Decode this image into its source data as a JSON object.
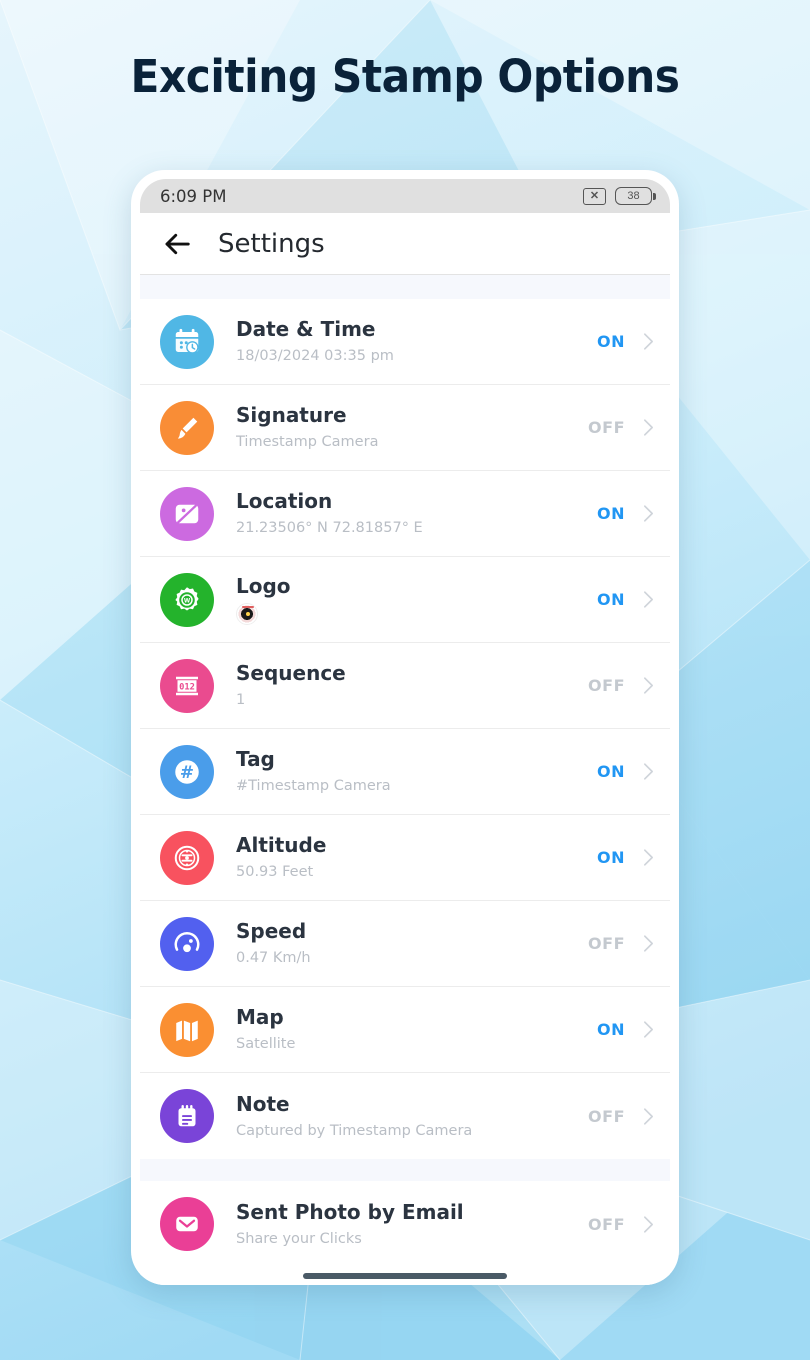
{
  "headline": "Exciting Stamp Options",
  "theme": {
    "background_top": "#e3f4fb",
    "background_bottom": "#a3dcf4",
    "headline_color": "#0a2239",
    "on_color": "#2196f3",
    "off_color": "#c4c9cf"
  },
  "phone": {
    "status_bar": {
      "time": "6:09 PM",
      "sim_icon": "sim-off-icon",
      "sim_glyph": "✕",
      "battery_level": "38"
    },
    "app_bar": {
      "back_icon": "back-arrow-icon",
      "title": "Settings"
    },
    "list": [
      {
        "name": "date-time",
        "title": "Date & Time",
        "subtitle": "18/03/2024 03:35 pm",
        "state": "ON",
        "icon": "calendar-clock-icon",
        "icon_color": "#50b7e5"
      },
      {
        "name": "signature",
        "title": "Signature",
        "subtitle": "Timestamp Camera",
        "state": "OFF",
        "icon": "signature-pen-icon",
        "icon_color": "#f98d36"
      },
      {
        "name": "location",
        "title": "Location",
        "subtitle": "21.23506° N 72.81857° E",
        "state": "ON",
        "icon": "map-pin-icon",
        "icon_color": "#cc6ae0"
      },
      {
        "name": "logo",
        "title": "Logo",
        "subtitle": "",
        "subtitle_is_thumbnail": true,
        "state": "ON",
        "icon": "logo-badge-icon",
        "icon_color": "#24b32c"
      },
      {
        "name": "sequence",
        "title": "Sequence",
        "subtitle": "1",
        "state": "OFF",
        "icon": "counter-012-icon",
        "icon_color": "#ea4b8f"
      },
      {
        "name": "tag",
        "title": "Tag",
        "subtitle": "#Timestamp Camera",
        "state": "ON",
        "icon": "hashtag-icon",
        "icon_color": "#4a9dea"
      },
      {
        "name": "altitude",
        "title": "Altitude",
        "subtitle": "50.93 Feet",
        "state": "ON",
        "icon": "altitude-gauge-icon",
        "icon_color": "#f8525f"
      },
      {
        "name": "speed",
        "title": "Speed",
        "subtitle": "0.47 Km/h",
        "state": "OFF",
        "icon": "speedometer-icon",
        "icon_color": "#5260ef"
      },
      {
        "name": "map",
        "title": "Map",
        "subtitle": "Satellite",
        "state": "ON",
        "icon": "folded-map-icon",
        "icon_color": "#fa8f32"
      },
      {
        "name": "note",
        "title": "Note",
        "subtitle": "Captured by Timestamp Camera",
        "state": "OFF",
        "icon": "notepad-icon",
        "icon_color": "#7a44d8"
      },
      {
        "name": "sent-photo-by-email",
        "title": "Sent Photo by Email",
        "subtitle": "Share your Clicks",
        "state": "OFF",
        "icon": "envelope-icon",
        "icon_color": "#ea3f96"
      }
    ]
  }
}
